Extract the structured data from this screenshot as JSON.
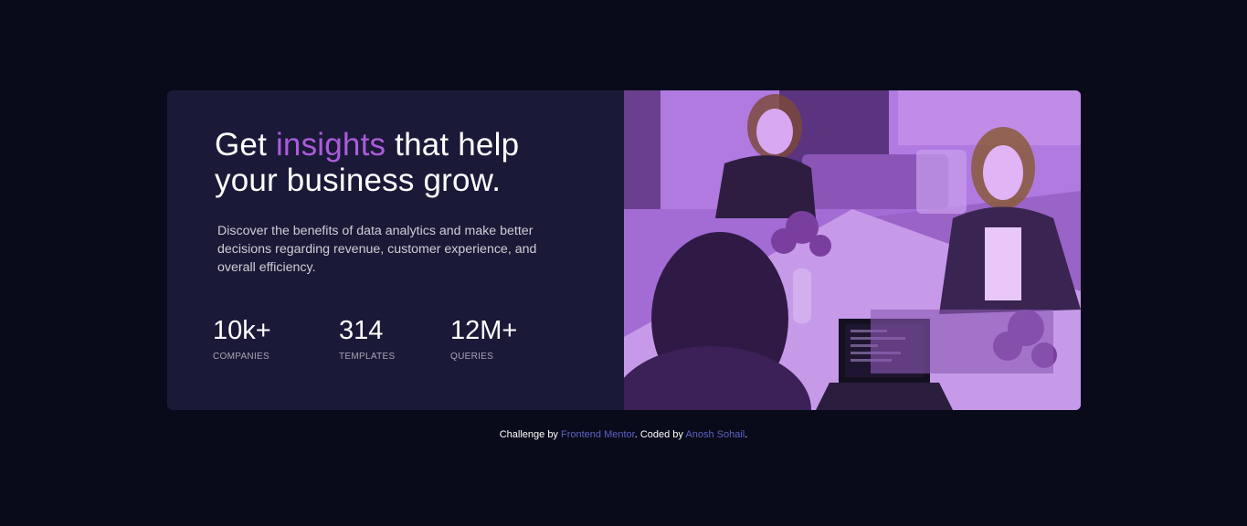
{
  "card": {
    "headline_part1": "Get ",
    "headline_accent": "insights",
    "headline_part2": " that help your business grow.",
    "description": "Discover the benefits of data analytics and make better decisions regarding revenue, customer experience, and overall efficiency.",
    "stats": [
      {
        "value": "10k+",
        "label": "Companies"
      },
      {
        "value": "314",
        "label": "Templates"
      },
      {
        "value": "12M+",
        "label": "Queries"
      }
    ],
    "image_subject": "team-meeting-photo"
  },
  "footer": {
    "prefix": "Challenge by ",
    "link1": "Frontend Mentor",
    "middle": ". Coded by ",
    "link2": "Anosh Sohail",
    "suffix": "."
  },
  "colors": {
    "background": "#090b1a",
    "card": "#1b1938",
    "accent": "#aa5cdb",
    "link": "#5d62c4"
  }
}
